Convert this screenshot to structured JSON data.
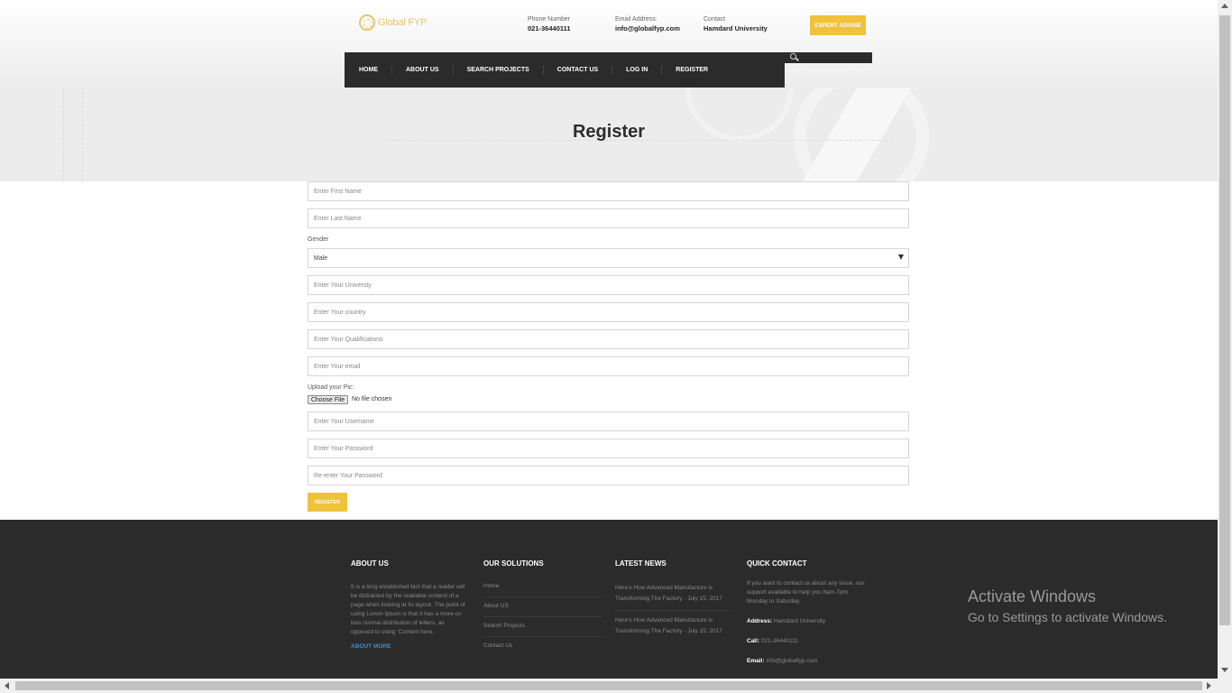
{
  "header": {
    "logo_text": "Global FYP",
    "phone_label": "Phone Number",
    "phone_value": "021-36440111",
    "email_label": "Email Address:",
    "email_value": "info@globalfyp.com",
    "contact_label": "Contact",
    "contact_value": "Hamdard University",
    "expert_button": "EXPERT ADVISE"
  },
  "nav": {
    "items": [
      "HOME",
      "ABOUT US",
      "SEARCH PROJECTS",
      "CONTACT US",
      "LOG IN",
      "REGISTER"
    ]
  },
  "banner": {
    "title": "Register"
  },
  "form": {
    "first_name_placeholder": "Enter First Name",
    "last_name_placeholder": "Enter Last Name",
    "gender_label": "Gender",
    "gender_value": "Male",
    "university_placeholder": "Enter Your Universty",
    "country_placeholder": "Enter Your country",
    "qualifications_placeholder": "Enter Your Qualifications",
    "email_placeholder": "Enter Your email",
    "upload_label": "Upload your Pic:",
    "choose_file_label": "Choose File",
    "file_status": "No file chosen",
    "username_placeholder": "Enter Your Username",
    "password_placeholder": "Enter Your Password",
    "reenter_password_placeholder": "Re-enter Your Password",
    "register_button": "REGISTER"
  },
  "footer": {
    "about": {
      "heading": "ABOUT US",
      "text": "It is a long established fact that a reader will be distracted by the readable content of a page when looking at its layout. The point of using Lorem Ipsum is that it has a more-or-less normal distribution of letters, as opposed to using 'Content here,",
      "more_link": "ABOUT MORE"
    },
    "solutions": {
      "heading": "OUR SOLUTIONS",
      "links": [
        "Home",
        "About US",
        "Search Projects",
        "Contact Us"
      ]
    },
    "news": {
      "heading": "LATEST NEWS",
      "items": [
        "Here's How Advanced Manufacture is Transforming The Factory - July 15, 2017",
        "Here's How Advanced Manufacture is Transforming The Factory - July 15, 2017"
      ]
    },
    "contact": {
      "heading": "QUICK CONTACT",
      "intro": "If you want to contact us about any issue, our support available to help you 8am-7pm Monday to Saturday.",
      "address_label": "Address:",
      "address_value": "Hamdard University",
      "call_label": "Call:",
      "call_value": "021-36440111",
      "email_label": "Email:",
      "email_value": "info@globalfyp.com"
    }
  },
  "watermark": {
    "line1": "Activate Windows",
    "line2": "Go to Settings to activate Windows."
  },
  "colors": {
    "accent": "#f0c23a",
    "nav_bg": "#2b2b2b",
    "link": "#3b8fd4"
  }
}
